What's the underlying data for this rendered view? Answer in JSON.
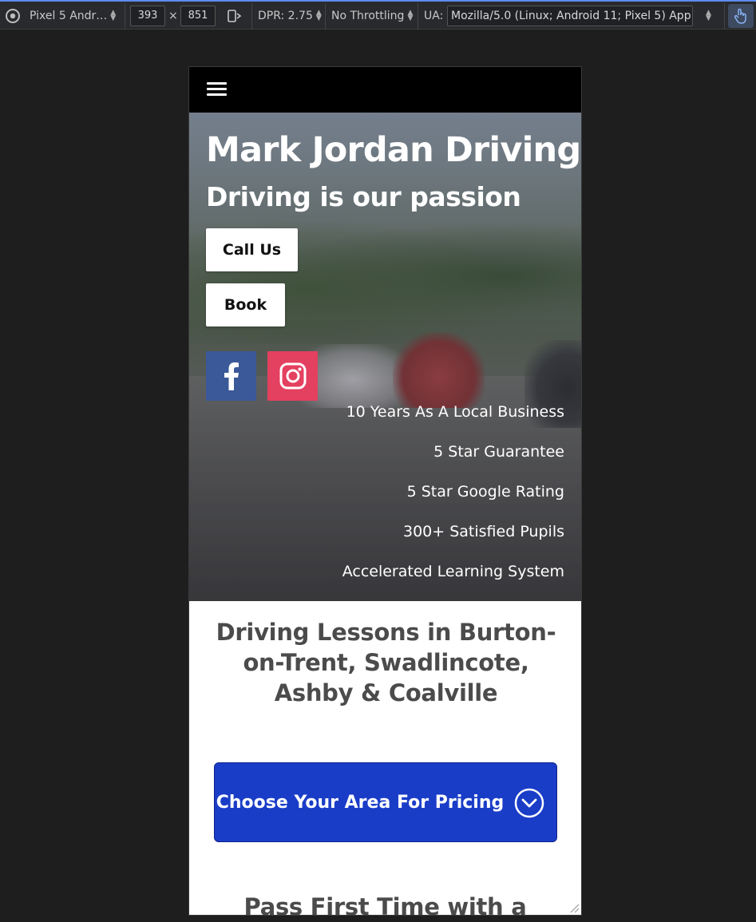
{
  "devtools": {
    "device_name": "Pixel 5 Andr…",
    "width": "393",
    "times": "×",
    "height": "851",
    "dpr_label": "DPR: 2.75",
    "throttling": "No Throttling",
    "ua_label": "UA:",
    "ua_value": "Mozilla/5.0 (Linux; Android 11; Pixel 5) App"
  },
  "hero": {
    "title": "Mark Jordan Driving",
    "subtitle": "Driving is our passion",
    "call_label": "Call Us",
    "book_label": "Book",
    "usps": [
      "10 Years As A Local Business",
      "5 Star Guarantee",
      "5 Star Google Rating",
      "300+ Satisfied Pupils",
      "Accelerated Learning System"
    ]
  },
  "main": {
    "section_title": "Driving Lessons in Burton-on-Trent, Swadlincote, Ashby & Coalville",
    "area_button_label": "Choose Your Area For Pricing",
    "next_title": "Pass First Time with a"
  },
  "colors": {
    "facebook": "#3b5998",
    "instagram": "#e4405f",
    "area_button": "#1a3dc8",
    "nav_bg": "#000000"
  }
}
